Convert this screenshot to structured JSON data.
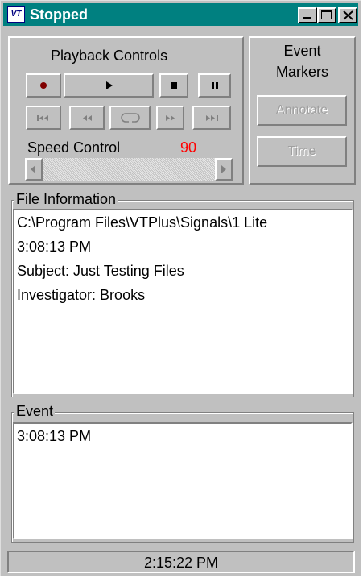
{
  "window": {
    "title": "Stopped",
    "icon_text": "VT",
    "minimize_icon": "minimize-icon",
    "maximize_icon": "maximize-icon",
    "close_icon": "close-icon"
  },
  "playback": {
    "title": "Playback Controls",
    "buttons_row1": [
      {
        "name": "record",
        "icon": "record-icon"
      },
      {
        "name": "play",
        "icon": "play-icon"
      },
      {
        "name": "stop",
        "icon": "stop-icon"
      },
      {
        "name": "pause",
        "icon": "pause-icon"
      }
    ],
    "buttons_row2": [
      {
        "name": "skip-to-start",
        "icon": "skip-start-icon"
      },
      {
        "name": "rewind",
        "icon": "rewind-icon"
      },
      {
        "name": "loop",
        "icon": "loop-icon"
      },
      {
        "name": "fast-forward",
        "icon": "fast-forward-icon"
      },
      {
        "name": "skip-to-end",
        "icon": "skip-end-icon"
      }
    ],
    "speed_label": "Speed Control",
    "speed_value": "90",
    "speed_color": "#ff0000"
  },
  "event_markers": {
    "title_line1": "Event",
    "title_line2": "Markers",
    "annotate_label": "Annotate",
    "time_label": "Time"
  },
  "file_info": {
    "legend": "File Information",
    "lines": [
      "C:\\Program Files\\VTPlus\\Signals\\1 Lite",
      "3:08:13 PM",
      "Subject:     Just Testing Files",
      "Investigator:  Brooks"
    ]
  },
  "event": {
    "legend": "Event",
    "lines": [
      "3:08:13 PM"
    ]
  },
  "status_bar": {
    "time": "2:15:22 PM"
  },
  "colors": {
    "title_bar": "#008080",
    "face": "#c0c0c0",
    "record_dot": "#800000"
  }
}
